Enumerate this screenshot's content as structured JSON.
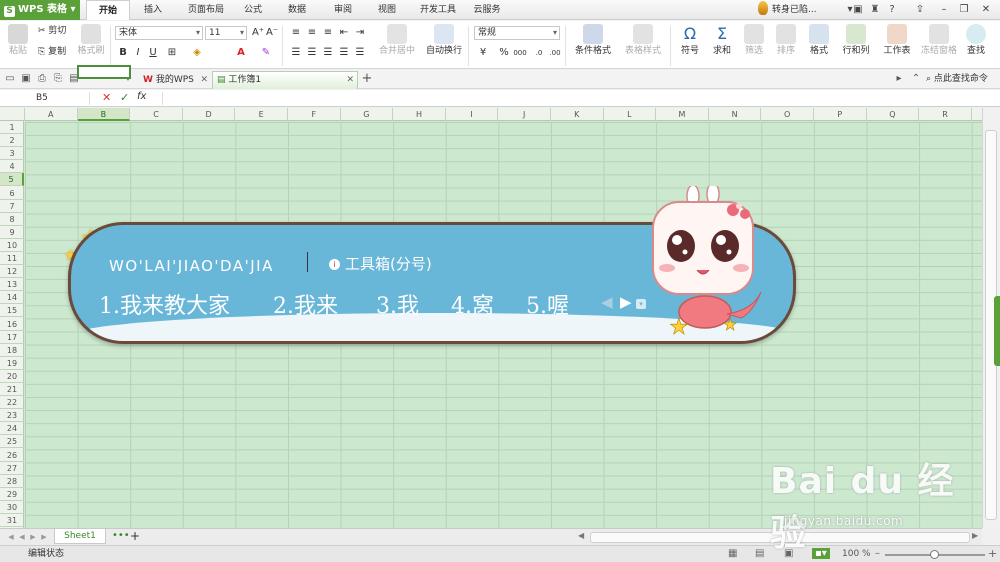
{
  "app": {
    "name": "WPS 表格",
    "logo_letter": "S",
    "account": "转身已陷..."
  },
  "menu_tabs": [
    "开始",
    "插入",
    "页面布局",
    "公式",
    "数据",
    "审阅",
    "视图",
    "开发工具",
    "云服务"
  ],
  "active_menu_tab": "开始",
  "ribbon": {
    "paste": "粘贴",
    "cut": "剪切",
    "copy": "复制",
    "format_painter": "格式刷",
    "font_name": "宋体",
    "font_size": "11",
    "bold": "B",
    "italic": "I",
    "underline": "U",
    "merge_center": "合并居中",
    "wrap_text": "自动换行",
    "number_format": "常规",
    "percent": "%",
    "comma": "000",
    "conditional_format": "条件格式",
    "table_style": "表格样式",
    "symbol": "符号",
    "sum": "求和",
    "filter": "筛选",
    "sort": "排序",
    "format": "格式",
    "row_col": "行和列",
    "worksheet": "工作表",
    "freeze": "冻结窗格",
    "find": "查找"
  },
  "doc_tabs": [
    {
      "label": "我的WPS",
      "active": false
    },
    {
      "label": "工作簿1",
      "active": true
    }
  ],
  "search_command": "点此查找命令",
  "formula_bar": {
    "name_box": "B5",
    "cancel": "✕",
    "confirm": "✓",
    "fx": "fx",
    "value": ""
  },
  "columns": [
    "A",
    "B",
    "C",
    "D",
    "E",
    "F",
    "G",
    "H",
    "I",
    "J",
    "K",
    "L",
    "M",
    "N",
    "O",
    "P",
    "Q",
    "R"
  ],
  "rows": [
    "1",
    "2",
    "3",
    "4",
    "5",
    "6",
    "7",
    "8",
    "9",
    "10",
    "11",
    "12",
    "13",
    "14",
    "15",
    "16",
    "17",
    "18",
    "19",
    "20",
    "21",
    "22",
    "23",
    "24",
    "25",
    "26",
    "27",
    "28",
    "29",
    "30",
    "31"
  ],
  "selected_column": "B",
  "selected_row": "5",
  "sheet_tabs": [
    "Sheet1"
  ],
  "status": {
    "mode": "编辑状态",
    "zoom": "100 %"
  },
  "ime": {
    "pinyin": "WO'LAI'JIAO'DA'JIA",
    "toolbox": "工具箱(分号)",
    "candidates": [
      "1.我来教大家",
      "2.我来",
      "3.我",
      "4.窝",
      "5.喔"
    ]
  },
  "watermark": {
    "brand": "Bai du 经验",
    "url": "jingyan.baidu.com"
  },
  "colors": {
    "accent": "#5aa13a",
    "grid_bg": "#cce8cf",
    "ime_bg": "#68b6d8"
  }
}
